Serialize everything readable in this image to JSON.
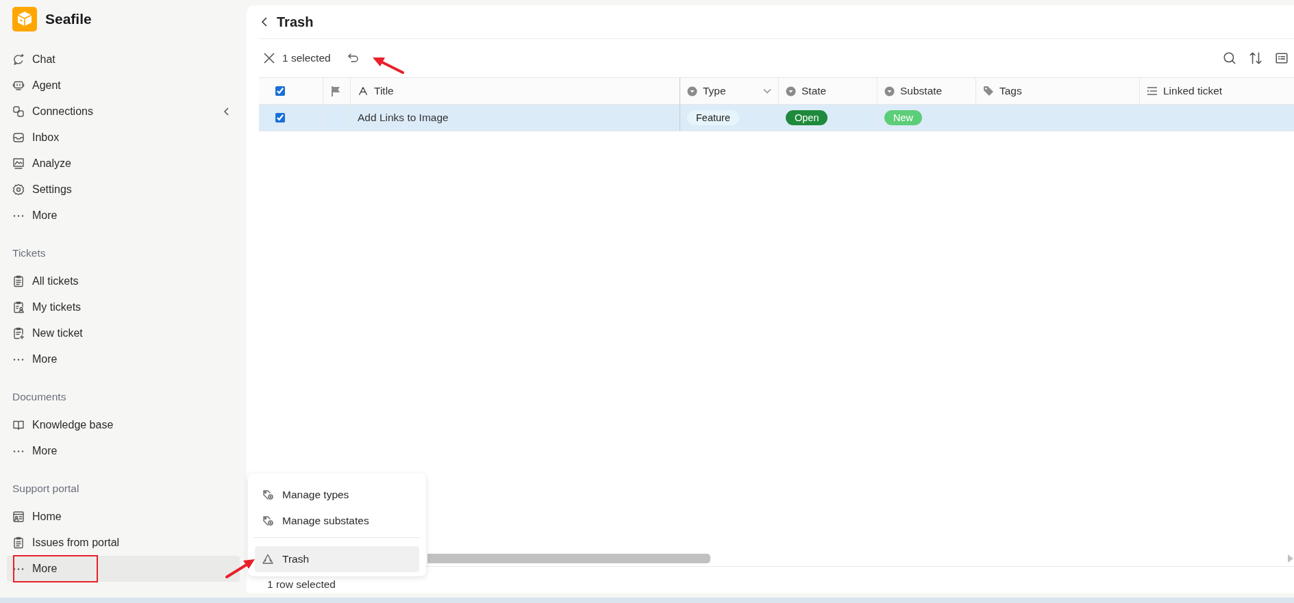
{
  "app": {
    "name": "Seafile"
  },
  "sidebar": {
    "sections": [
      {
        "items": [
          {
            "label": "Chat",
            "kind": "link",
            "selected": false
          },
          {
            "label": "Agent",
            "kind": "link",
            "selected": false
          },
          {
            "label": "Connections",
            "kind": "group",
            "selected": false
          },
          {
            "label": "Inbox",
            "kind": "link",
            "selected": false
          },
          {
            "label": "Analyze",
            "kind": "link",
            "selected": false
          },
          {
            "label": "Settings",
            "kind": "link",
            "selected": false
          },
          {
            "label": "More",
            "kind": "more",
            "selected": false
          }
        ]
      },
      {
        "title": "Tickets",
        "items": [
          {
            "label": "All tickets",
            "kind": "link",
            "selected": false
          },
          {
            "label": "My tickets",
            "kind": "link",
            "selected": false
          },
          {
            "label": "New ticket",
            "kind": "link",
            "selected": false
          },
          {
            "label": "More",
            "kind": "more",
            "selected": false
          }
        ]
      },
      {
        "title": "Documents",
        "items": [
          {
            "label": "Knowledge base",
            "kind": "link",
            "selected": false
          },
          {
            "label": "More",
            "kind": "more",
            "selected": false
          }
        ]
      },
      {
        "title": "Support portal",
        "items": [
          {
            "label": "Home",
            "kind": "link",
            "selected": false
          },
          {
            "label": "Issues from portal",
            "kind": "link",
            "selected": false
          },
          {
            "label": "More",
            "kind": "more",
            "selected": true
          }
        ]
      }
    ]
  },
  "header": {
    "title": "Trash"
  },
  "toolbar": {
    "selection": "1 selected"
  },
  "table": {
    "columns": [
      {
        "kind": "checkbox",
        "checked": true
      },
      {
        "kind": "flag"
      },
      {
        "kind": "text",
        "label": "Title",
        "dropdown": false
      },
      {
        "kind": "select",
        "label": "Type",
        "dropdown": true
      },
      {
        "kind": "select",
        "label": "State",
        "dropdown": false
      },
      {
        "kind": "select",
        "label": "Substate",
        "dropdown": false
      },
      {
        "kind": "tags",
        "label": "Tags",
        "dropdown": false
      },
      {
        "kind": "link",
        "label": "Linked ticket",
        "dropdown": false
      }
    ],
    "rows": [
      {
        "checked": true,
        "selected": true,
        "title": "Add Links to Image",
        "type": {
          "tag": "Feature",
          "color": "#e6f4fb"
        },
        "state": {
          "tag": "Open",
          "color": "#1e8a3c"
        },
        "substate": {
          "tag": "New",
          "color": "#5ccd78"
        }
      }
    ]
  },
  "menu": {
    "groups": [
      [
        {
          "label": "Manage types",
          "selected": false
        },
        {
          "label": "Manage substates",
          "selected": false
        }
      ],
      [
        {
          "label": "Trash",
          "selected": true
        }
      ]
    ]
  },
  "status_bar": "1 row selected"
}
